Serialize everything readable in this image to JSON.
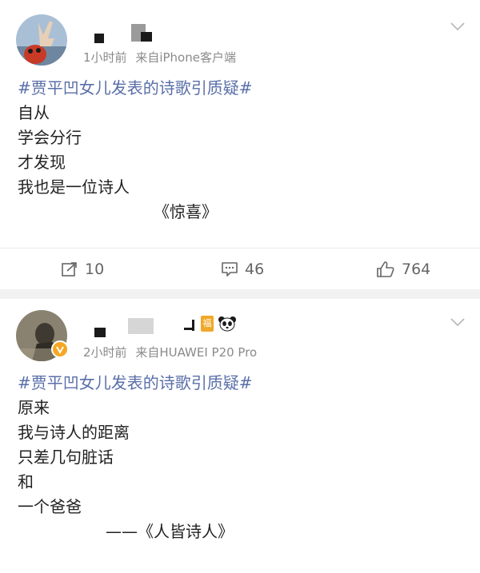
{
  "posts": [
    {
      "meta": {
        "time": "1小时前",
        "source": "来自iPhone客户端"
      },
      "hashtag": "#贾平凹女儿发表的诗歌引质疑#",
      "lines": [
        "自从",
        "学会分行",
        "才发现",
        "我也是一位诗人"
      ],
      "poem_title": "《惊喜》",
      "actions": {
        "repost": "10",
        "comment": "46",
        "like": "764"
      }
    },
    {
      "meta": {
        "time": "2小时前",
        "source": "来自HUAWEI P20 Pro"
      },
      "badge_text": "福",
      "hashtag": "#贾平凹女儿发表的诗歌引质疑#",
      "lines": [
        "原来",
        "我与诗人的距离",
        "只差几句脏话",
        "和",
        "一个爸爸"
      ],
      "poem_title": "——《人皆诗人》"
    }
  ],
  "icons": {
    "repost": "repost-icon",
    "comment": "comment-icon",
    "like": "like-icon",
    "menu": "chevron-down-icon"
  },
  "colors": {
    "hashtag": "#5a6fa8",
    "meta": "#8a8a8a",
    "verified_badge": "#f5a623"
  }
}
